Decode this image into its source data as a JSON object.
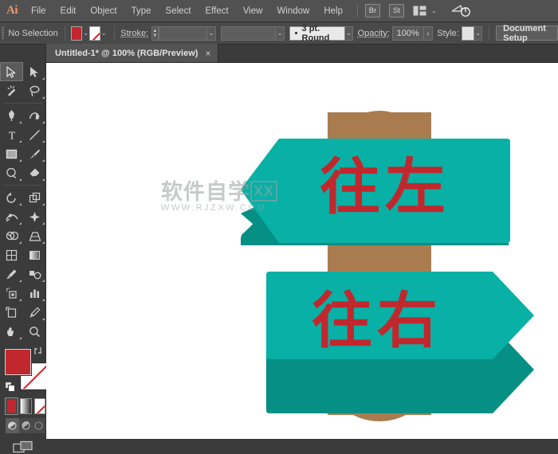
{
  "app": {
    "logo": "Ai",
    "menus": [
      "File",
      "Edit",
      "Object",
      "Type",
      "Select",
      "Effect",
      "View",
      "Window",
      "Help"
    ],
    "bridge_button": "Br",
    "stock_button": "St",
    "workspace_caret": "⌄",
    "cloud_icon": "cloud-sync-icon"
  },
  "control_bar": {
    "selection_status": "No Selection",
    "fill_color": "#c0282d",
    "fill_swatch_name": "fill-color-swatch",
    "stroke_swatch_name": "stroke-none-swatch",
    "stroke_label": "Stroke:",
    "stroke_weight_value": "",
    "variable_width_profile": "",
    "brush_definition": "3 pt. Round",
    "opacity_label": "Opacity:",
    "opacity_value": "100%",
    "style_label": "Style:",
    "document_setup_button": "Document Setup",
    "caret": "⌄"
  },
  "tabs": [
    {
      "title": "Untitled-1* @ 100% (RGB/Preview)",
      "close": "×"
    }
  ],
  "toolbar": {
    "rows": [
      [
        "selection-tool",
        "direct-selection-tool"
      ],
      [
        "magic-wand-tool",
        "lasso-tool"
      ],
      [
        "pen-tool",
        "curvature-tool"
      ],
      [
        "type-tool",
        "line-segment-tool"
      ],
      [
        "rectangle-tool",
        "paintbrush-tool"
      ],
      [
        "shaper-tool",
        "eraser-tool"
      ],
      [
        "rotate-tool",
        "scale-tool"
      ],
      [
        "width-tool",
        "free-transform-tool"
      ],
      [
        "shape-builder-tool",
        "perspective-grid-tool"
      ],
      [
        "mesh-tool",
        "gradient-tool"
      ],
      [
        "eyedropper-tool",
        "blend-tool"
      ],
      [
        "symbol-sprayer-tool",
        "column-graph-tool"
      ],
      [
        "artboard-tool",
        "slice-tool"
      ],
      [
        "hand-tool",
        "zoom-tool"
      ]
    ],
    "active_tool": "selection-tool",
    "fill_color": "#c0282d",
    "stroke_color": "#ffffff",
    "color_modes": [
      "color-mode-button",
      "gradient-mode-button",
      "none-mode-button"
    ],
    "draw_modes": [
      "draw-normal-button",
      "draw-behind-button",
      "draw-inside-button"
    ],
    "screen_mode": "change-screen-mode-button"
  },
  "artwork": {
    "post_color": "#a97c50",
    "sign_face_color": "#08b0a6",
    "sign_shadow_color": "#058f85",
    "text_color": "#c0282d",
    "signs": [
      {
        "label": "往左",
        "direction": "left",
        "name": "sign-left"
      },
      {
        "label": "往右",
        "direction": "right",
        "name": "sign-right"
      }
    ],
    "watermark": {
      "chinese": "软件自学",
      "badge": "XX",
      "url": "WWW.RJZXW.COM"
    }
  }
}
